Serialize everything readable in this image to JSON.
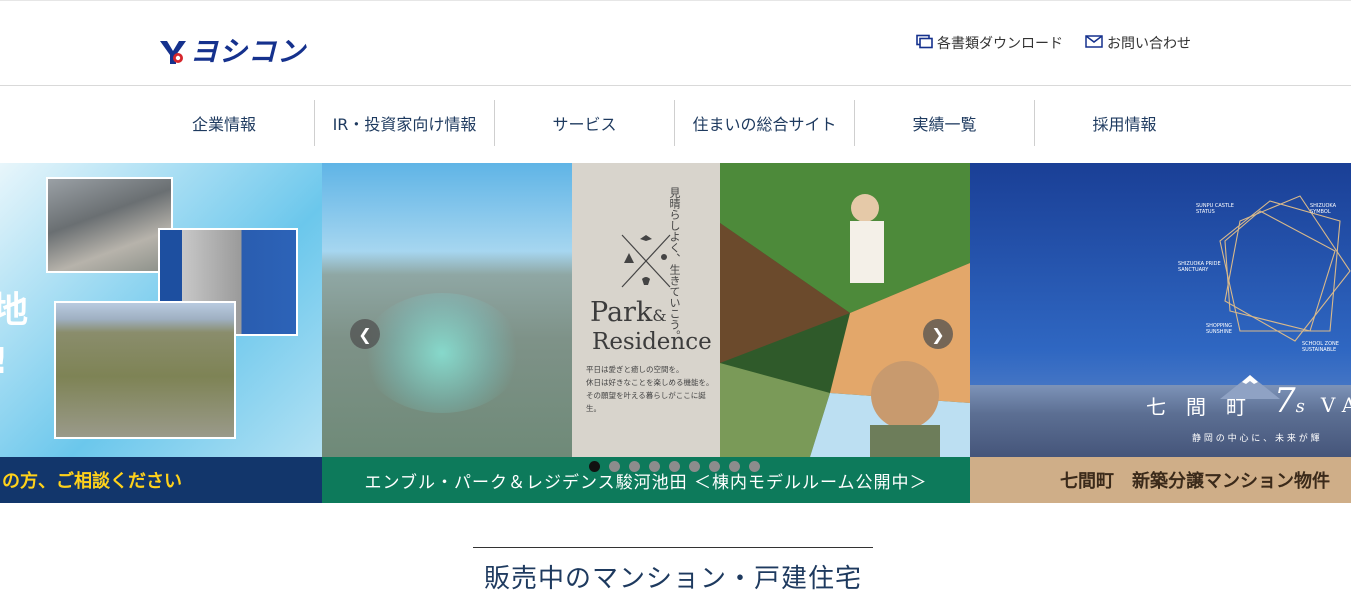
{
  "header": {
    "logo_text": "ヨシコン",
    "links": [
      {
        "label": "各書類ダウンロード",
        "icon": "monitor-icon"
      },
      {
        "label": "お問い合わせ",
        "icon": "mail-icon"
      }
    ]
  },
  "nav": {
    "items": [
      "企業情報",
      "IR・投資家向け情報",
      "サービス",
      "住まいの総合サイト",
      "実績一覧",
      "採用情報"
    ]
  },
  "carousel": {
    "slides": [
      {
        "caption": "の方、ご相談ください",
        "big_chars": [
          "地",
          "!"
        ]
      },
      {
        "caption": "エンブル・パーク＆レジデンス駿河池田 ＜棟内モデルルーム公開中＞",
        "banner_title_1": "Park",
        "banner_amp": "&",
        "banner_title_2": "Residence",
        "banner_tagline": "見晴らしよく、生きていこう。",
        "banner_lines": [
          "平日は愛ぎと癒しの空間を。",
          "休日は好きなことを楽しめる機能を。",
          "その願望を叶える暮らしがここに誕生。"
        ]
      },
      {
        "caption": "七間町　新築分譲マンション物件",
        "headline": "七　間　町",
        "brand_main": "7",
        "brand_sub": "s",
        "brand_tail": "V A",
        "subline": "静 岡 の 中 心 に 、 未 来 が 輝",
        "star_labels": [
          {
            "text": "SUNPU CASTLE\nSTATUS"
          },
          {
            "text": "SHIZUOKA\nSYMBOL"
          },
          {
            "text": "SHIZUOKA PRIDE\nSANCTUARY"
          },
          {
            "text": "SHOPPING\nSUNSHINE"
          },
          {
            "text": "SCHOOL ZONE\nSUSTAINABLE"
          }
        ]
      }
    ],
    "prev_icon": "chevron-left-icon",
    "next_icon": "chevron-right-icon",
    "dot_count": 9,
    "active_dot": 0
  },
  "section": {
    "title": "販売中のマンション・戸建住宅"
  },
  "colors": {
    "brand": "#15318d",
    "nav_text": "#1e3a5f",
    "caption_left_bg": "#12366b",
    "caption_left_text": "#ffd21a",
    "caption_mid_bg": "#0d7a5b",
    "caption_right_bg": "#cfae88"
  }
}
